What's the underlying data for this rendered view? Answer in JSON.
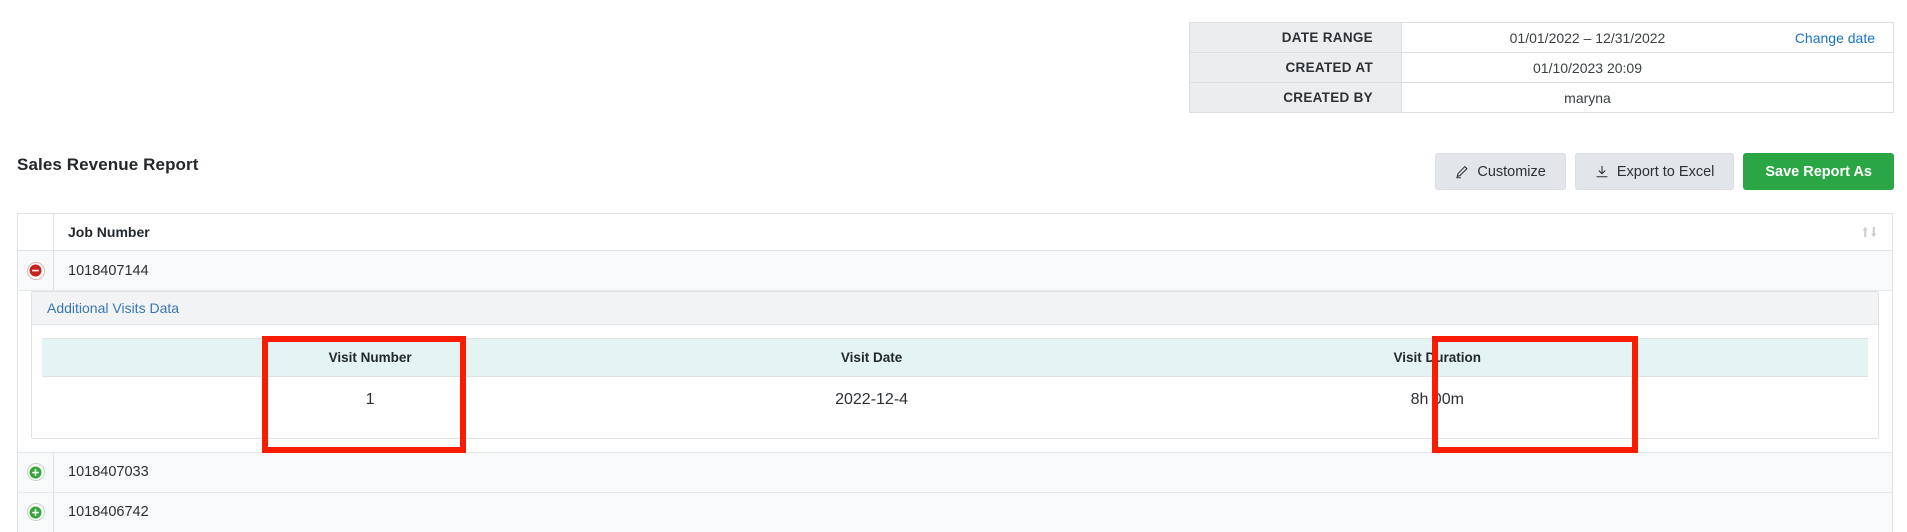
{
  "meta": {
    "rows": [
      {
        "label": "DATE RANGE",
        "value": "01/01/2022 – 12/31/2022",
        "action": "Change date"
      },
      {
        "label": "CREATED AT",
        "value": "01/10/2023 20:09",
        "action": ""
      },
      {
        "label": "CREATED BY",
        "value": "maryna",
        "action": ""
      }
    ]
  },
  "report": {
    "title": "Sales Revenue Report"
  },
  "toolbar": {
    "customize_label": "Customize",
    "export_label": "Export to Excel",
    "save_label": "Save Report As",
    "primary_color": "#2aa744",
    "secondary_color": "#e2e6ea"
  },
  "grid": {
    "header": {
      "job_number": "Job Number"
    },
    "rows": [
      {
        "job_number": "1018407144",
        "expanded": true,
        "toggle": "collapse-minus-icon"
      },
      {
        "job_number": "1018407033",
        "expanded": false,
        "toggle": "expand-plus-icon"
      },
      {
        "job_number": "1018406742",
        "expanded": false,
        "toggle": "expand-plus-icon"
      }
    ]
  },
  "detail": {
    "panel_title": "Additional Visits Data",
    "panel_title_color": "#3877b5",
    "header_bg": "#e4f4f2",
    "columns": [
      "",
      "Visit Number",
      "Visit Date",
      "Visit Duration",
      ""
    ],
    "rows": [
      {
        "blank": "",
        "visit_number": "1",
        "visit_date": "2022-12-4",
        "visit_duration": "8h 00m",
        "tail": ""
      }
    ]
  },
  "annotations": {
    "color": "#f91c00",
    "boxes": [
      {
        "name": "visit-number-column",
        "label": "Visit Number"
      },
      {
        "name": "visit-duration-column",
        "label": "Visit Duration"
      }
    ]
  }
}
